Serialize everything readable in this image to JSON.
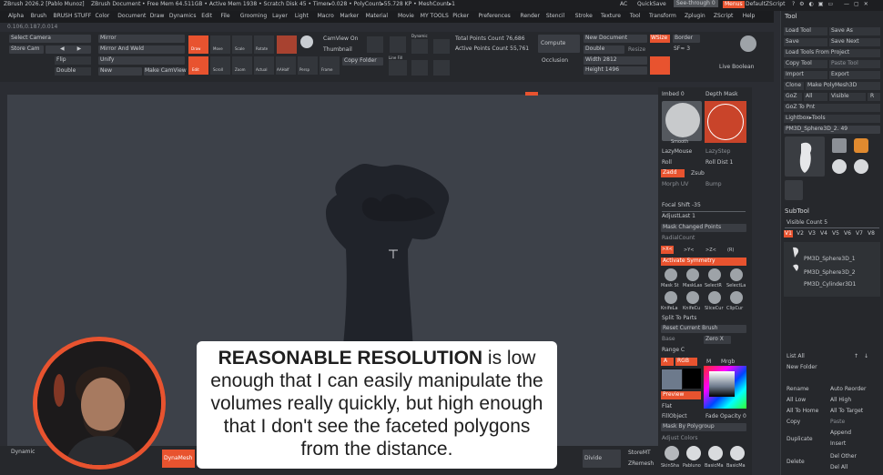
{
  "titlebar": {
    "app": "ZBrush 2026.2 [Pablo Munoz]",
    "document": "ZBrush Document",
    "stats": "• Free Mem 64.511GB • Active Mem 1938 • Scratch Disk 45 • Timer▸0.028 • PolyCount▸55.728 KP • MeshCount▸1",
    "ac": "AC",
    "quicksave": "QuickSave",
    "seethrough": "See-through 0",
    "menus_label": "Menus",
    "default_script": "DefaultZScript"
  },
  "menubar": [
    "Alpha",
    "Brush",
    "BRUSH STUFF",
    "Color",
    "Document",
    "Draw",
    "Dynamics",
    "Edit",
    "File",
    "Grooming",
    "Layer",
    "Light",
    "Macro",
    "Marker",
    "Material",
    "Movie",
    "MY TOOLS",
    "Picker",
    "Preferences",
    "Render",
    "Stencil",
    "Stroke",
    "Texture",
    "Tool",
    "Transform",
    "Zplugin",
    "ZScript",
    "Help"
  ],
  "coords": "0.106,0.187,0.014",
  "toolbar": {
    "select_camera": "Select Camera",
    "store_cam": "Store Cam",
    "flip": "Flip",
    "double": "Double",
    "mirror": "Mirror",
    "mirror_weld": "Mirror And Weld",
    "unify": "Unify",
    "new": "New",
    "make_camview": "Make CamView",
    "camview_on": "CamView On",
    "thumbnail": "Thumbnail",
    "copy_folder": "Copy Folder",
    "dynamic": "Dynamic",
    "total_points": "Total Points Count 76,686",
    "active_points": "Active Points Count 55,761",
    "compute": "Compute",
    "occlusion": "Occlusion",
    "new_document": "New Document",
    "double2": "Double",
    "resize": "Resize",
    "width": "Width 2812",
    "height": "Height 1496",
    "wsize": "WSize",
    "border": "Border",
    "sf": "SF≈ 3",
    "live_boolean": "Live Boolean",
    "draw_label": "Draw",
    "move_label": "Move",
    "scale_label": "Scale",
    "rotate_label": "Rotate",
    "edit_label": "Edit",
    "scroll_label": "Scroll",
    "zoom_label": "Zoom",
    "actual_label": "Actual",
    "aahalf_label": "AAHalf",
    "persp_label": "Persp",
    "frame_label": "Frame",
    "line_fill": "Line Fill",
    "polyf": "PolyF"
  },
  "tool_panel": {
    "title": "Tool",
    "load_tool": "Load Tool",
    "save_as": "Save As",
    "save": "Save",
    "save_next": "Save Next",
    "load_tools_project": "Load Tools From Project",
    "copy_tool": "Copy Tool",
    "paste_tool": "Paste Tool",
    "import": "Import",
    "export": "Export",
    "clone": "Clone",
    "make_polymesh": "Make PolyMesh3D",
    "goz": "GoZ",
    "all": "All",
    "visible": "Visible",
    "r": "R",
    "goz_forpaint": "GoZ To Pnt",
    "lightbox_tools": "Lightbox▸Tools",
    "current_tool": "PM3D_Sphere3D_2. 49",
    "thumbs": [
      "PM3D_Sphere3D",
      "Cylinder3D",
      "SimpleB",
      "PM3D_Sphere3D",
      "Sphere3D",
      "Sphere3D",
      "PM3D_"
    ],
    "subtool": "SubTool",
    "visible_count": "Visible Count 5",
    "v_tabs": [
      "V1",
      "V2",
      "V3",
      "V4",
      "V5",
      "V6",
      "V7",
      "V8"
    ],
    "subtools": [
      "PM3D_Sphere3D_1",
      "PM3D_Sphere3D_2",
      "PM3D_Cylinder3D1"
    ],
    "list_all": "List All",
    "new_folder": "New Folder",
    "rename": "Rename",
    "autoreorder": "Auto Reorder",
    "all_low": "All Low",
    "all_high": "All High",
    "all_to_home": "All To Home",
    "all_to_target": "All To Target",
    "copy": "Copy",
    "paste": "Paste",
    "duplicate": "Duplicate",
    "append": "Append",
    "insert": "Insert",
    "delete": "Delete",
    "del_other": "Del Other",
    "del_all": "Del All"
  },
  "brush_panel": {
    "imbed": "Imbed 0",
    "depth_mask": "Depth Mask",
    "smooth": "Smooth",
    "lazymouse": "LazyMouse",
    "lazystep": "LazyStep",
    "roll": "Roll",
    "roll_dist": "Roll Dist 1",
    "zadd": "Zadd",
    "zsub": "Zsub",
    "morph_uv": "Morph UV",
    "bump": "Bump",
    "focal_shift": "Focal Shift -35",
    "adjust_last": "AdjustLast 1",
    "masked_changed": "Mask Changed Points",
    "radial_count": "RadialCount",
    "x_sym": ">X<",
    "y_sym": ">Y<",
    "z_sym": ">Z<",
    "r_sym": "(R)",
    "activate_symmetry": "Activate Symmetry",
    "mask_labels": [
      "Mask St",
      "MaskLas",
      "SelectR",
      "SelectLa"
    ],
    "knife_labels": [
      "KnifeLa",
      "KnifeCu",
      "SliceCur",
      "ClipCur"
    ],
    "split_to_parts": "Split To Parts",
    "reset_current": "Reset Current Brush",
    "base": "Base",
    "zero_x": "Zero X",
    "range": "Range C",
    "a": "A",
    "rgb": "RGB",
    "m": "M",
    "mrgb": "Mrgb",
    "preview": "Preview",
    "flat": "Flat",
    "fillobject": "FillObject",
    "fade_opacity": "Fade Opacity 0",
    "mask_by_polygroup": "Mask By Polygroup",
    "adjust_colors": "Adjust Colors",
    "bottom_labels": [
      "SkinSha",
      "Pabluno",
      "BasicMa",
      "BasicMa"
    ]
  },
  "bottom_bar": {
    "dynamic": "Dynamic",
    "dynamesh": "DynaMesh",
    "divide": "Divide",
    "store_mt": "StoreMT",
    "zremesh": "ZRemesh"
  },
  "caption": {
    "bold": "REASONABLE RESOLUTION",
    "text": " is low enough that I can easily manipulate the volumes really quickly, but high enough that I don't see the faceted polygons from the distance."
  },
  "colors": {
    "accent": "#e8532f",
    "viewport": "#3d4149",
    "panel": "#26282c"
  }
}
